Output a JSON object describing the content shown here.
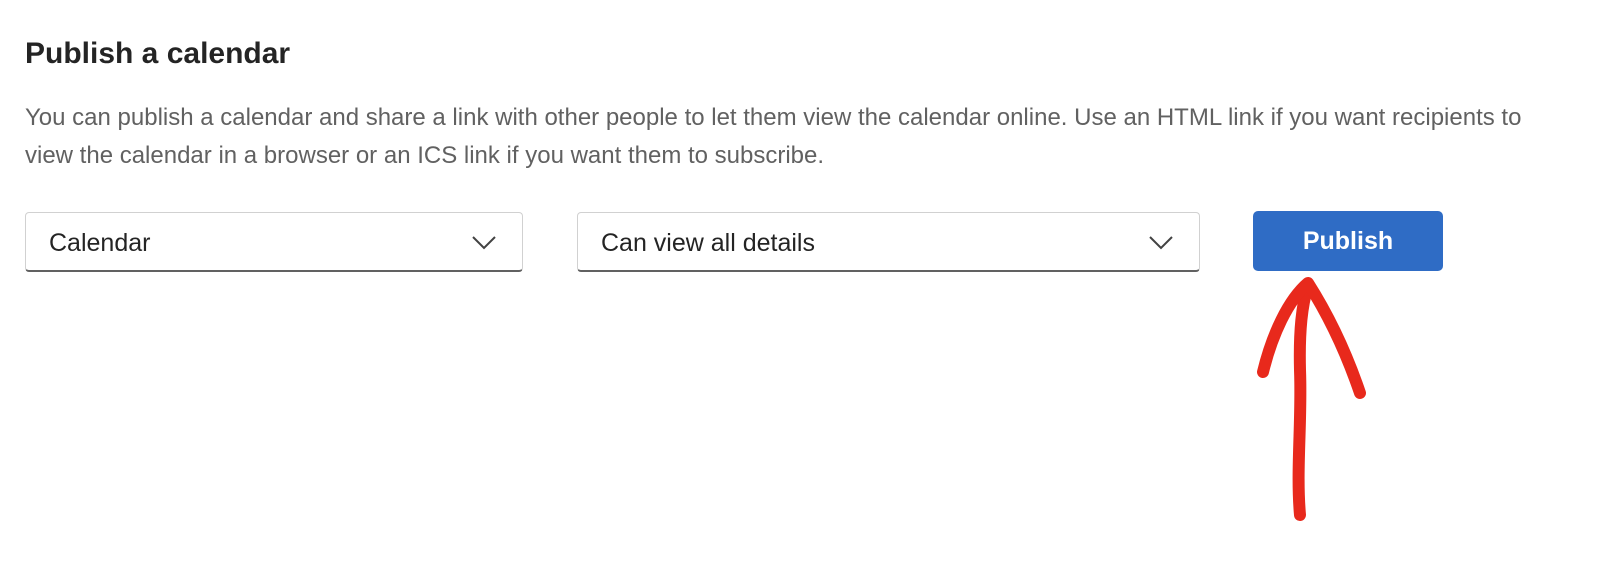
{
  "section": {
    "title": "Publish a calendar",
    "description": "You can publish a calendar and share a link with other people to let them view the calendar online. Use an HTML link if you want recipients to view the calendar in a browser or an ICS link if you want them to subscribe."
  },
  "calendar_select": {
    "value": "Calendar",
    "icon": "chevron-down-icon"
  },
  "permission_select": {
    "value": "Can view all details",
    "icon": "chevron-down-icon"
  },
  "publish_button": {
    "label": "Publish",
    "color": "#2f6cc5"
  },
  "annotation": {
    "type": "hand-drawn-arrow",
    "color": "#e8291c",
    "points_to": "publish_button"
  }
}
